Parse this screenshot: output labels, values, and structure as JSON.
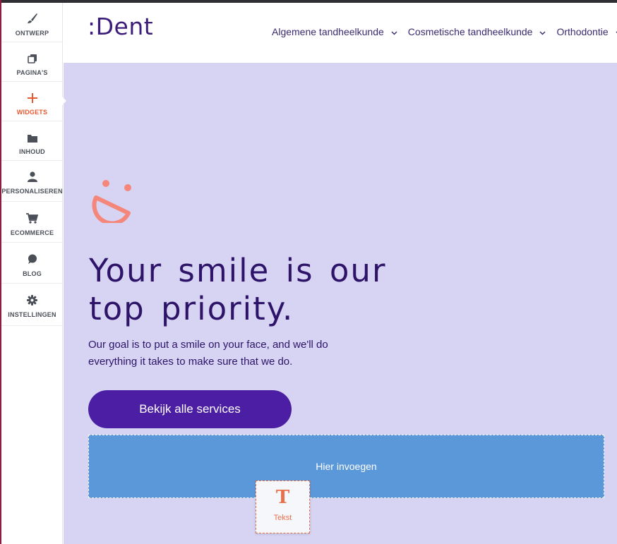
{
  "sidebar": {
    "items": [
      {
        "label": "ONTWERP",
        "icon": "brush-icon"
      },
      {
        "label": "PAGINA'S",
        "icon": "pages-icon"
      },
      {
        "label": "WIDGETS",
        "icon": "plus-icon",
        "active": true
      },
      {
        "label": "INHOUD",
        "icon": "folder-icon"
      },
      {
        "label": "PERSONALISEREN",
        "icon": "person-icon"
      },
      {
        "label": "ECOMMERCE",
        "icon": "cart-icon"
      },
      {
        "label": "BLOG",
        "icon": "chat-bubble-icon"
      },
      {
        "label": "INSTELLINGEN",
        "icon": "gear-icon"
      }
    ],
    "active_color": "#e8592f"
  },
  "site": {
    "logo": ":Dent",
    "nav": [
      "Algemene tandheelkunde",
      "Cosmetische tandheelkunde",
      "Orthodontie"
    ]
  },
  "hero": {
    "headline": "Your smile is our top priority.",
    "subtext": "Our goal is to put a smile on your face, and we'll do everything it takes to make sure that we do.",
    "cta_label": "Bekijk alle services",
    "background": "#d6d3f3",
    "accent": "#4b1ea3"
  },
  "editor": {
    "drop_label": "Hier invoegen",
    "drag_widget_label": "Tekst",
    "drag_widget_icon": "T"
  }
}
